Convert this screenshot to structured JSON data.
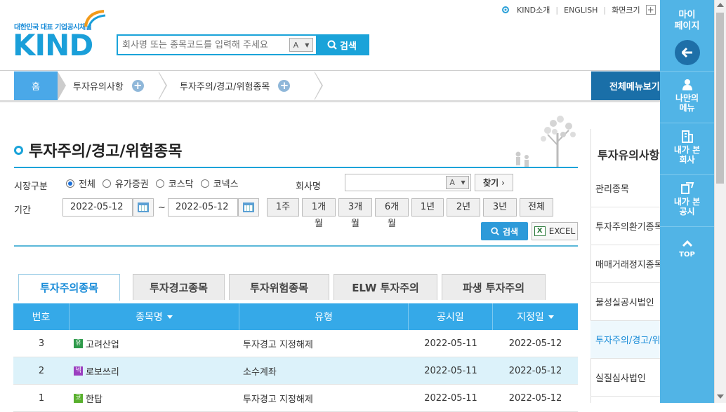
{
  "header": {
    "logo_subtitle": "대한민국 대표 기업공시채널",
    "logo_text": "KIND",
    "search_placeholder": "회사명 또는 종목코드를 입력해 주세요",
    "autocomplete_label": "A",
    "search_button": "검색",
    "top_links": {
      "about": "KIND소개",
      "english": "ENGLISH",
      "screen_size": "화면크기"
    }
  },
  "nav": {
    "home": "홈",
    "crumb1": "투자유의사항",
    "crumb2": "투자주의/경고/위험종목",
    "all_menu": "전체메뉴보기"
  },
  "page": {
    "title": "투자주의/경고/위험종목"
  },
  "filters": {
    "market_label": "시장구분",
    "market_options": [
      "전체",
      "유가증권",
      "코스닥",
      "코넥스"
    ],
    "market_selected": "전체",
    "company_label": "회사명",
    "company_value": "",
    "find_button": "찾기",
    "period_label": "기간",
    "date_from": "2022-05-12",
    "date_sep": "~",
    "date_to": "2022-05-12",
    "period_buttons": [
      "1주",
      "1개월",
      "3개월",
      "6개월",
      "1년",
      "2년",
      "3년",
      "전체"
    ],
    "search_button": "검색",
    "excel_button": "EXCEL"
  },
  "tabs": [
    "투자주의종목",
    "투자경고종목",
    "투자위험종목",
    "ELW 투자주의",
    "파생 투자주의"
  ],
  "active_tab": "투자주의종목",
  "table": {
    "headers": {
      "no": "번호",
      "name": "종목명",
      "type": "유형",
      "notice_date": "공시일",
      "designated_date": "지정일"
    },
    "rows": [
      {
        "no": "3",
        "market_badge": "유",
        "market_color": "#2e9a4a",
        "name": "고려산업",
        "type": "투자경고 지정해제",
        "notice_date": "2022-05-11",
        "designated_date": "2022-05-12"
      },
      {
        "no": "2",
        "market_badge": "넥",
        "market_color": "#9b3fc0",
        "name": "로보쓰리",
        "type": "소수계좌",
        "notice_date": "2022-05-11",
        "designated_date": "2022-05-12"
      },
      {
        "no": "1",
        "market_badge": "코",
        "market_color": "#58b02d",
        "name": "한탑",
        "type": "투자경고 지정해제",
        "notice_date": "2022-05-11",
        "designated_date": "2022-05-12"
      }
    ]
  },
  "right_panel": {
    "title": "투자유의사항",
    "items": [
      "관리종목",
      "투자주의환기종목",
      "매매거래정지종목",
      "불성실공시법인",
      "투자주의/경고/위험종목",
      "실질심사법인"
    ],
    "selected_index": 4
  },
  "side_menu": {
    "my_page": "마이\n페이지",
    "my_menu": "나만의\n메뉴",
    "my_companies": "내가 본\n회사",
    "my_disclosures": "내가 본\n공시",
    "top": "TOP"
  },
  "colors": {
    "accent": "#1aa3d9",
    "table_header": "#35a9e8",
    "side_menu": "#51b4e6"
  }
}
